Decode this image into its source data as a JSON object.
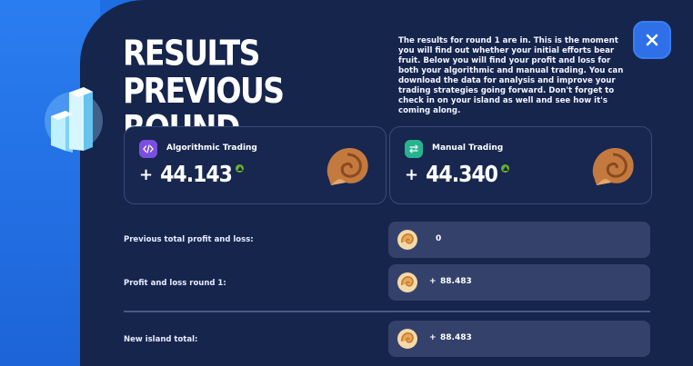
{
  "header": {
    "title": "RESULTS PREVIOUS ROUND",
    "intro": "The results for round 1 are in. This is the moment you will find out whether your initial efforts bear fruit. Below you will find your profit and loss for both your algorithmic and manual trading. You can download the data for analysis and improve your trading strategies going forward. Don't forget to check in on your island as well and see how it's coming along.",
    "close_icon": "close-icon"
  },
  "cards": {
    "algorithmic": {
      "label": "Algorithmic Trading",
      "sign": "+",
      "value": "44.143",
      "icon": "code-icon",
      "icon_color": "#7b4ee0"
    },
    "manual": {
      "label": "Manual Trading",
      "sign": "+",
      "value": "44.340",
      "icon": "swap-icon",
      "icon_color": "#27b38e"
    }
  },
  "rows": {
    "previous": {
      "label": "Previous total profit and loss:",
      "sign": "",
      "amount": "0"
    },
    "round": {
      "label": "Profit and loss round 1:",
      "sign": "+",
      "amount": "88.483"
    },
    "total": {
      "label": "New island total:",
      "sign": "+",
      "amount": "88.483"
    }
  },
  "colors": {
    "panel": "#16254c",
    "accent": "#1f6de2",
    "positive": "#6bb02c",
    "pill": "#34426b"
  }
}
